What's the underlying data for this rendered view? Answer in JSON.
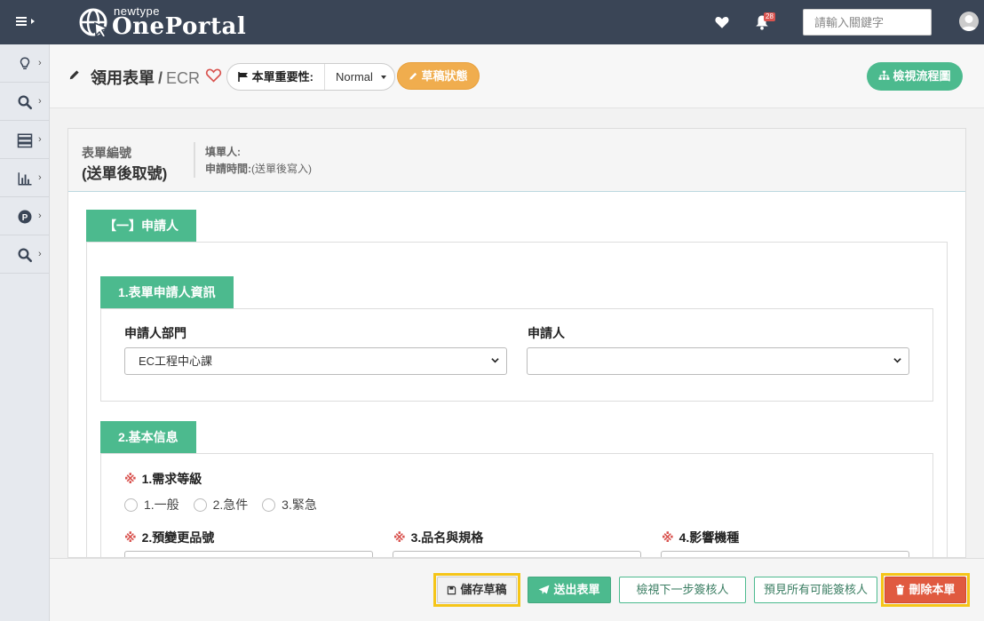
{
  "topbar": {
    "logo_small": "newtype",
    "logo_big": "OnePortal",
    "notification_count": "28",
    "search_placeholder": "請輸入關鍵字"
  },
  "header": {
    "title": "領用表單",
    "separator": "/",
    "form_code": "ECR",
    "importance_label": "本單重要性:",
    "importance_value": "Normal",
    "status_button": "草稿狀態",
    "flow_button": "檢視流程圖"
  },
  "form_info": {
    "form_no_label": "表單編號",
    "form_no_value": "(送單後取號)",
    "filler_label": "填單人:",
    "apply_time_label": "申請時間:",
    "apply_time_value": "(送單後寫入)"
  },
  "section_main": {
    "title": "【一】申請人"
  },
  "subsection_applicant": {
    "title": "1.表單申請人資訊",
    "dept_label": "申請人部門",
    "dept_value": "EC工程中心課",
    "applicant_label": "申請人",
    "applicant_value": ""
  },
  "subsection_basic": {
    "title": "2.基本信息",
    "required_mark": "※",
    "demand_level_label": "1.需求等級",
    "demand_options": [
      "1.一般",
      "2.急件",
      "3.緊急"
    ],
    "part_no_label": "2.預變更品號",
    "product_label": "3.品名與規格",
    "model_label": "4.影響機種"
  },
  "footer": {
    "save_draft": "儲存草稿",
    "submit": "送出表單",
    "view_next": "檢視下一步簽核人",
    "preview_all": "預見所有可能簽核人",
    "delete": "刪除本單"
  },
  "colors": {
    "navbar": "#3a4556",
    "accent_green": "#4cba8e",
    "draft_orange": "#f0ad4e",
    "danger_red": "#e05a40",
    "highlight_yellow": "#f5c518"
  }
}
